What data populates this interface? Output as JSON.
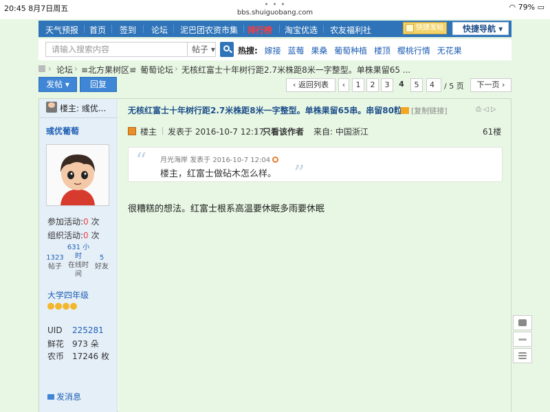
{
  "status": {
    "time": "20:45",
    "date": "8月7日周五",
    "url": "bbs.shuiguobang.com",
    "battery": "79%"
  },
  "topnav": {
    "items": [
      "天气预报",
      "首页",
      "签到",
      "论坛",
      "泥巴团农资市集",
      "排行榜",
      "淘宝优选",
      "农友福利社"
    ],
    "quick_post": "快捷发帖",
    "quick_nav": "快捷导航"
  },
  "search": {
    "placeholder": "请输入搜索内容",
    "type": "帖子",
    "hot_label": "热搜:",
    "hot": [
      "嫁接",
      "蓝莓",
      "果桑",
      "葡萄种植",
      "楼顶",
      "樱桃行情",
      "无花果"
    ]
  },
  "breadcrumb": [
    "论坛",
    "≡北方果树区≡",
    "葡萄论坛",
    "无核红富士十年树行距2.7米株距8米一字整型。单株果留65 ..."
  ],
  "actions": {
    "post": "发帖",
    "reply": "回复"
  },
  "pager": {
    "back": "返回列表",
    "pages": [
      "1",
      "2",
      "3",
      "4",
      "5"
    ],
    "current_input": "4",
    "total": "/ 5 页",
    "next": "下一页"
  },
  "sidebar": {
    "header": "楼主: 彧优...",
    "username": "彧优葡萄",
    "activity_join_label": "参加活动:",
    "activity_join_value": "0",
    "activity_unit": "次",
    "activity_org_label": "组织活动:",
    "activity_org_value": "0",
    "stats": [
      {
        "value": "1323",
        "label": "帖子"
      },
      {
        "value": "631 小时",
        "label": "在线时间"
      },
      {
        "value": "5",
        "label": "好友"
      }
    ],
    "grade": "大学四年级",
    "uid_label": "UID",
    "uid": "225281",
    "flower_label": "鲜花",
    "flower": "973 朵",
    "coin_label": "农币",
    "coin": "17246 枚",
    "message": "发消息"
  },
  "post": {
    "title": "无核红富士十年树行距2.7米株距8米一字整型。单株果留65串。串留80粒",
    "copy_link": "[复制链接]",
    "author_tag": "楼主",
    "posted": "发表于 2016-10-7 12:17",
    "only_author": "只看该作者",
    "from": "来自:  中国浙江",
    "floor": "61楼",
    "quote_header": "月光海岸 发表于 2016-10-7 12:04",
    "quote_text": "楼主，红富士做砧木怎么样。",
    "body": "很糟糕的想法。红富士根系高温要休眠多雨要休眠"
  },
  "colors": {
    "nav_blue": "#2f74b8",
    "content_bg": "#e8f7e4",
    "link": "#1e5fb4",
    "hot_red": "#ff3b3b"
  }
}
